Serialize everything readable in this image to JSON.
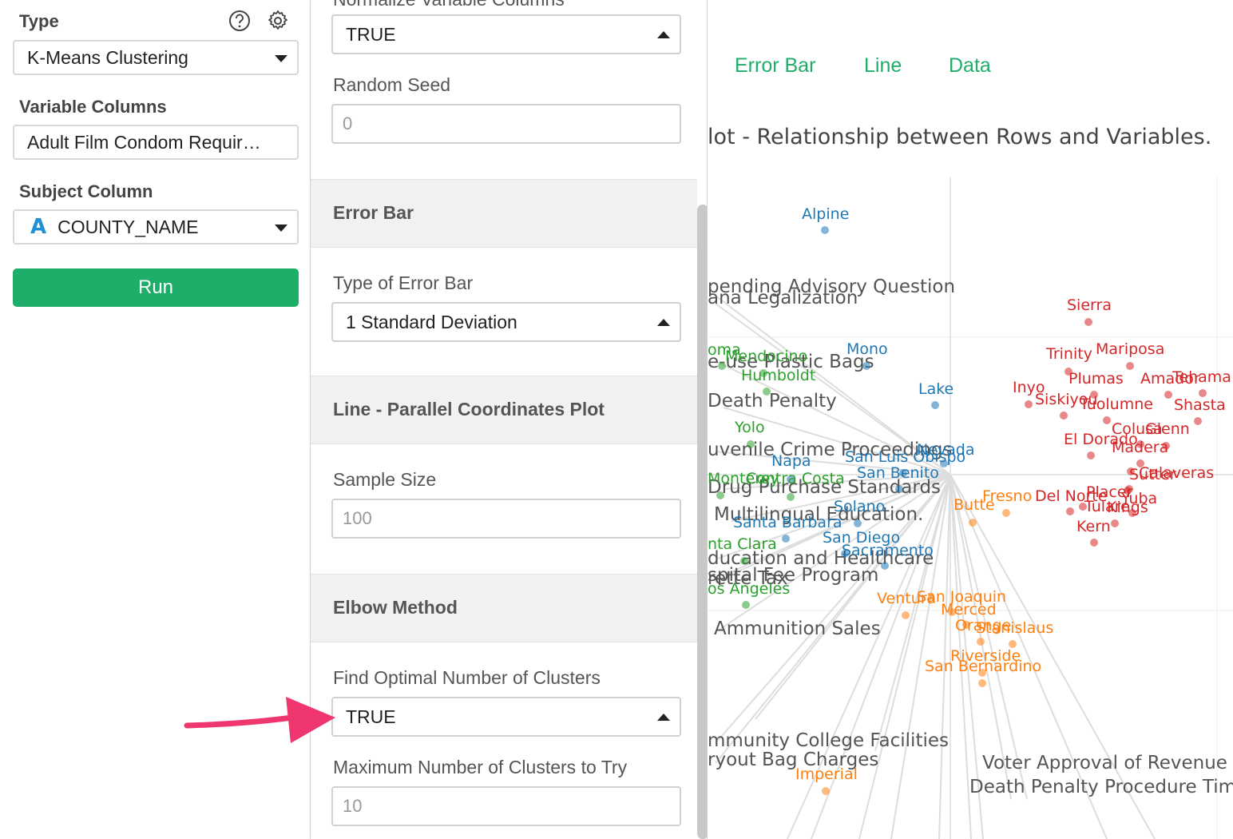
{
  "left": {
    "type_label": "Type",
    "type_value": "K-Means Clustering",
    "variable_columns_label": "Variable Columns",
    "variable_columns_value": "Adult Film Condom Requir…",
    "subject_column_label": "Subject Column",
    "subject_column_type_glyph": "A",
    "subject_column_value": "COUNTY_NAME",
    "run_label": "Run"
  },
  "middle": {
    "normalize_label_cut": "Normalize Variable Columns",
    "normalize_value": "TRUE",
    "random_seed_label": "Random Seed",
    "random_seed_placeholder": "0",
    "error_bar_header": "Error Bar",
    "type_of_error_bar_label": "Type of Error Bar",
    "type_of_error_bar_value": "1 Standard Deviation",
    "line_header": "Line - Parallel Coordinates Plot",
    "sample_size_label": "Sample Size",
    "sample_size_placeholder": "100",
    "elbow_header": "Elbow Method",
    "find_optimal_label": "Find Optimal Number of Clusters",
    "find_optimal_value": "TRUE",
    "max_clusters_label": "Maximum Number of Clusters to Try",
    "max_clusters_placeholder": "10"
  },
  "right": {
    "tabs": [
      "Error Bar",
      "Line",
      "Data"
    ],
    "title": "lot - Relationship between Rows and Variables."
  },
  "chart_data": {
    "type": "scatter",
    "title": "lot - Relationship between Rows and Variables.",
    "colors": {
      "blue": "#1f77b4",
      "green": "#2ca02c",
      "orange": "#ff7f0e",
      "red": "#d62728",
      "variable": "#555555",
      "loading_line": "#dddddd"
    },
    "variable_labels": [
      "pending Advisory Question",
      "ana Legalization",
      "e-use Plastic Bags",
      "Death Penalty",
      "uvenile Crime Proceedings",
      "Drug Purchase Standards",
      "Multilingual Education.",
      "ducation and Healthcare",
      "spital Fee Program",
      "rette Tax",
      "Ammunition Sales",
      "mmunity College Facilities",
      "ryout Bag Charges",
      "Voter Approval of Revenue B",
      "Death Penalty Procedure Time"
    ],
    "series": [
      {
        "name": "blue",
        "points": [
          "Alpine",
          "Mono",
          "Lake",
          "Nevada",
          "San Luis Obispo",
          "Napa",
          "San Benito",
          "Solano",
          "Santa Barbara",
          "San Diego",
          "Sacramento"
        ]
      },
      {
        "name": "green",
        "points": [
          "oma",
          "Mendocino",
          "Humboldt",
          "Yolo",
          "Monterey",
          "Contra Costa",
          "nta Clara",
          "os Angeles"
        ]
      },
      {
        "name": "orange",
        "points": [
          "Fresno",
          "Butte",
          "Ventura",
          "San Joaquin",
          "Merced",
          "Orange",
          "Stanislaus",
          "Riverside",
          "San Bernardino",
          "Imperial"
        ]
      },
      {
        "name": "red",
        "points": [
          "Sierra",
          "Trinity",
          "Mariposa",
          "Plumas",
          "Amador",
          "Tehama",
          "Inyo",
          "Siskiyou",
          "Tuolumne",
          "Shasta",
          "Colusa",
          "Glenn",
          "El Dorado",
          "Madera",
          "Calaveras",
          "Sutter",
          "Del Norte",
          "Placer",
          "Yuba",
          "Tulare",
          "Kings",
          "Kern"
        ]
      }
    ]
  }
}
